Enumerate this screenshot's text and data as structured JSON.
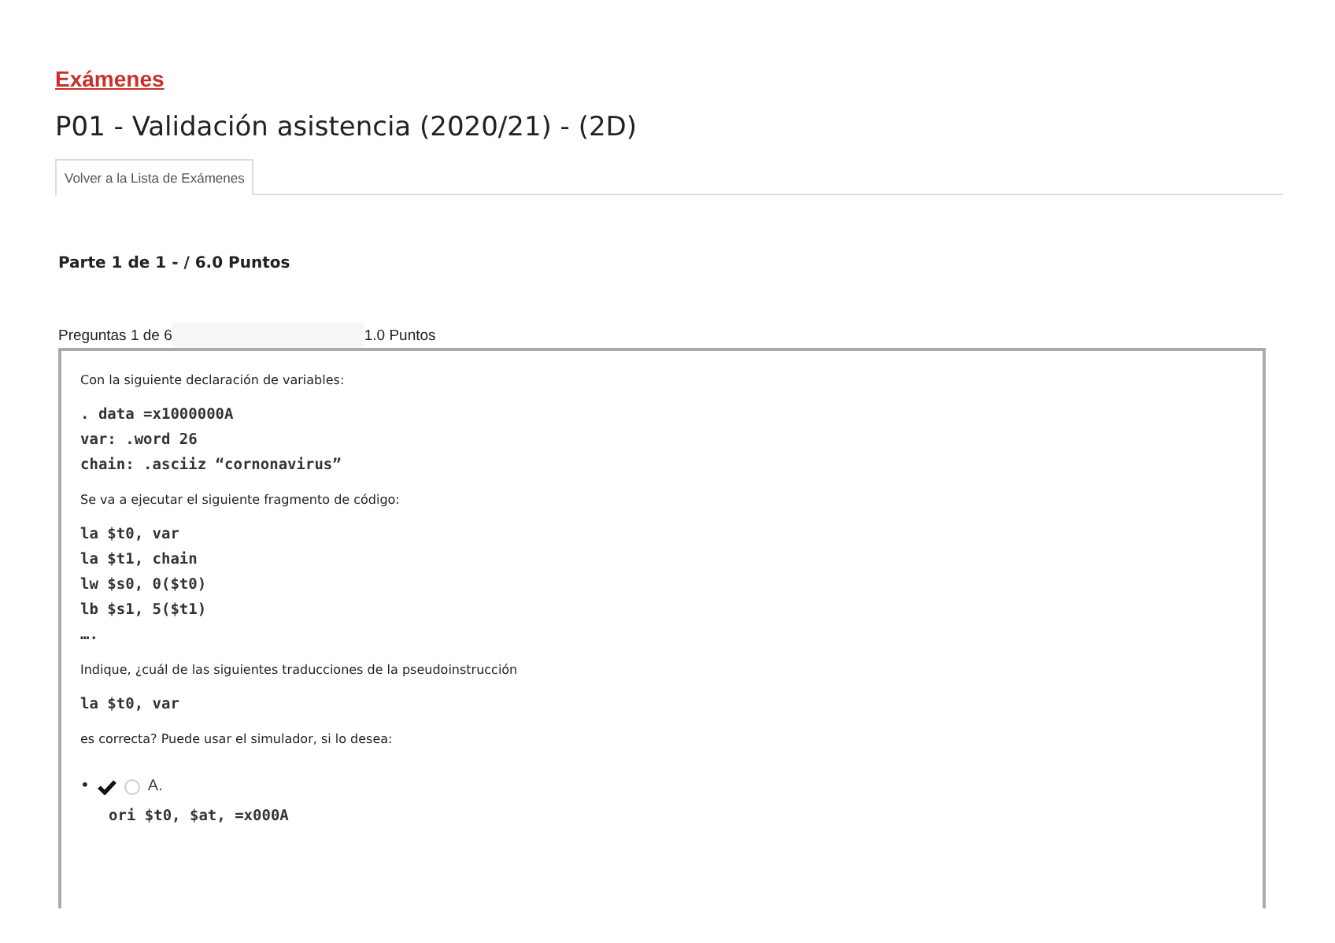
{
  "breadcrumb": {
    "label": "Exámenes"
  },
  "title": "P01 - Validación asistencia (2020/21) - (2D)",
  "tabs": [
    {
      "label": "Volver a la Lista de Exámenes",
      "selected": true
    }
  ],
  "part_heading": "Parte 1 de 1 - / 6.0 Puntos",
  "question_header": {
    "counter": "Preguntas 1 de 6",
    "points": "1.0 Puntos"
  },
  "question_blocks": [
    {
      "kind": "text",
      "lines": [
        "Con la siguiente declaración de variables:"
      ]
    },
    {
      "kind": "code",
      "lines": [
        ". data =x1000000A",
        "var: .word 26",
        "chain: .asciiz “cornonavirus”"
      ]
    },
    {
      "kind": "text",
      "lines": [
        "Se va a ejecutar el siguiente fragmento de código:"
      ]
    },
    {
      "kind": "code",
      "lines": [
        "la $t0, var",
        "la $t1, chain",
        "lw $s0, 0($t0)",
        "lb $s1, 5($t1)",
        "…."
      ]
    },
    {
      "kind": "text",
      "lines": [
        "Indique, ¿cuál de las siguientes traducciones de la pseudoinstrucción"
      ]
    },
    {
      "kind": "code",
      "lines": [
        "la $t0, var"
      ]
    },
    {
      "kind": "text",
      "lines": [
        "es correcta? Puede usar el simulador, si lo desea:"
      ]
    }
  ],
  "answers": [
    {
      "bullet": "•",
      "correct": true,
      "selected": false,
      "label": "A.",
      "code": "ori $t0, $at, =x000A"
    }
  ]
}
